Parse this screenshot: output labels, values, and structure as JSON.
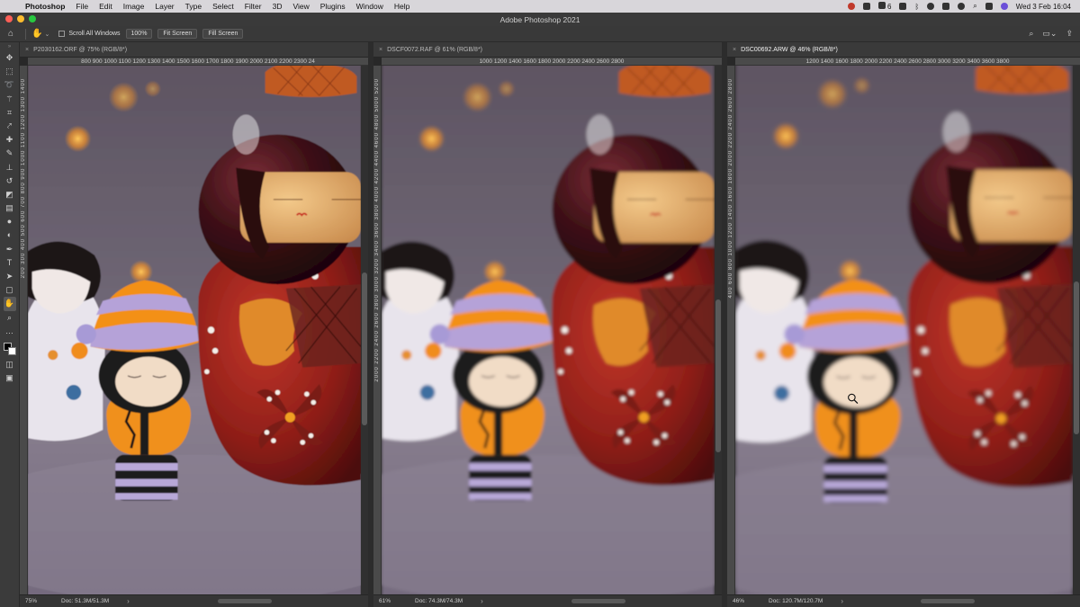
{
  "menubar": {
    "app": "Photoshop",
    "items": [
      "File",
      "Edit",
      "Image",
      "Layer",
      "Type",
      "Select",
      "Filter",
      "3D",
      "View",
      "Plugins",
      "Window",
      "Help"
    ],
    "badge_count": "6",
    "datetime": "Wed 3 Feb  16:04"
  },
  "window": {
    "title": "Adobe Photoshop 2021"
  },
  "options": {
    "scroll_all_label": "Scroll All Windows",
    "zoom_100_label": "100%",
    "fit_screen_label": "Fit Screen",
    "fill_screen_label": "Fill Screen"
  },
  "documents": [
    {
      "tab": "P2030162.ORF @ 75% (RGB/8*)",
      "active": false,
      "ruler_h": "800   900   1000   1100   1200   1300   1400   1500   1600   1700   1800   1900   2000   2100   2200   2300   24",
      "ruler_v": "200   300   400   500   600   700   800   900   1000   1100   1200   1300   1400",
      "zoom": "75%",
      "doc_size": "Doc: 51.3M/51.3M",
      "blur": 2.2
    },
    {
      "tab": "DSCF0072.RAF @ 61% (RGB/8*)",
      "active": false,
      "ruler_h": "1000   1200   1400   1600   1800   2000   2200   2400   2600   2800",
      "ruler_v": "2000   2200   2400   2600   2800   3000   3200   3400   3600   3800   4000   4200   4400   4600   4800   5000   5200",
      "zoom": "61%",
      "doc_size": "Doc: 74.3M/74.3M",
      "blur": 3.6
    },
    {
      "tab": "DSC00692.ARW @ 46% (RGB/8*)",
      "active": true,
      "ruler_h": "1200   1400   1600   1800   2000   2200   2400   2600   2800   3000   3200   3400   3600   3800",
      "ruler_v": "400   600   800   1000   1200   1400   1600   1800   2000   2200   2400   2600   2800",
      "zoom": "46%",
      "doc_size": "Doc: 120.7M/120.7M",
      "blur": 4.5
    }
  ],
  "tools": [
    "move-tool",
    "artboard-tool",
    "lasso-tool",
    "magic-wand-tool",
    "crop-tool",
    "eyedropper-tool",
    "spot-healing-tool",
    "brush-tool",
    "clone-stamp-tool",
    "history-brush-tool",
    "eraser-tool",
    "gradient-tool",
    "blur-tool",
    "dodge-tool",
    "pen-tool",
    "type-tool",
    "path-selection-tool",
    "rectangle-tool",
    "hand-tool",
    "zoom-tool",
    "edit-toolbar-tool"
  ],
  "colors": {
    "foreground": "#000000",
    "background": "#ffffff",
    "accent": "#f39019"
  }
}
